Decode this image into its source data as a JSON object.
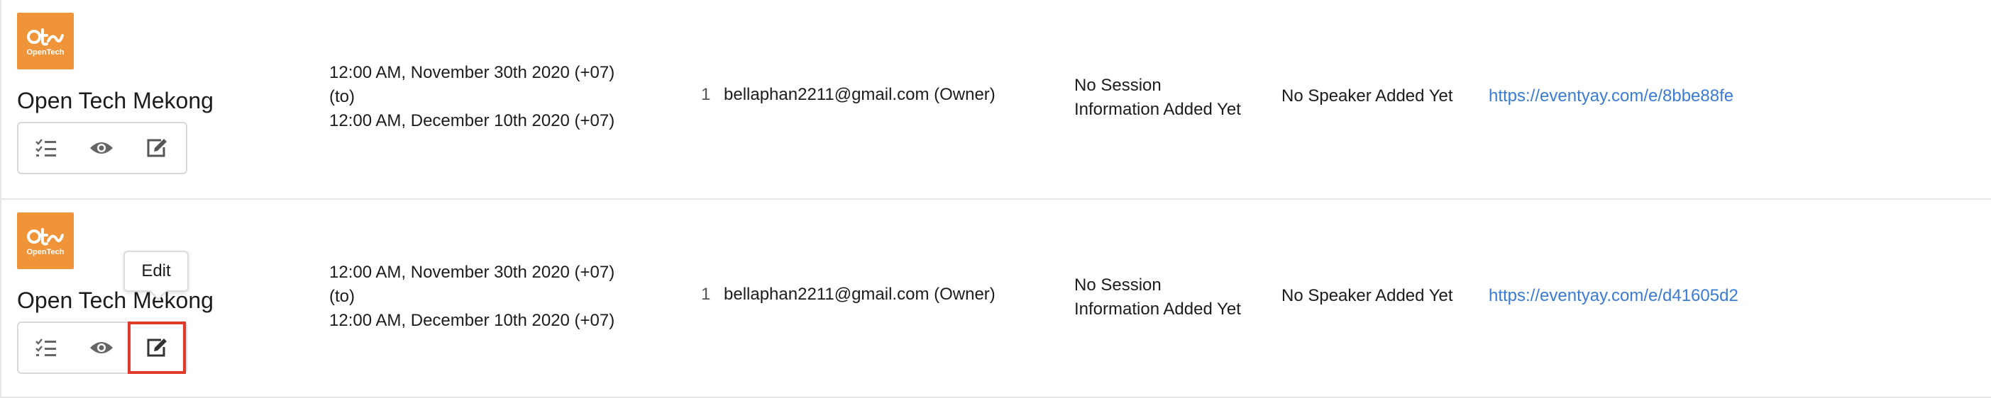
{
  "rows": [
    {
      "logo_text": "OpenTech",
      "name": "Open Tech Mekong",
      "date_start": "12:00 AM, November 30th 2020 (+07)",
      "date_to": "(to)",
      "date_end": "12:00 AM, December 10th 2020 (+07)",
      "count": "1",
      "owner": "bellaphan2211@gmail.com (Owner)",
      "session_line1": "No Session",
      "session_line2": "Information Added Yet",
      "speaker": "No Speaker Added Yet",
      "url": "https://eventyay.com/e/8bbe88fe"
    },
    {
      "logo_text": "OpenTech",
      "name": "Open Tech Mekong",
      "date_start": "12:00 AM, November 30th 2020 (+07)",
      "date_to": "(to)",
      "date_end": "12:00 AM, December 10th 2020 (+07)",
      "count": "1",
      "owner": "bellaphan2211@gmail.com (Owner)",
      "session_line1": "No Session",
      "session_line2": "Information Added Yet",
      "speaker": "No Speaker Added Yet",
      "url": "https://eventyay.com/e/d41605d2"
    }
  ],
  "tooltip": {
    "label": "Edit"
  },
  "icons": {
    "list": "list-check-icon",
    "view": "eye-icon",
    "edit": "edit-icon"
  },
  "colors": {
    "logo": "#f0943a",
    "link": "#3a7bd5",
    "highlight": "#e03a2b"
  }
}
